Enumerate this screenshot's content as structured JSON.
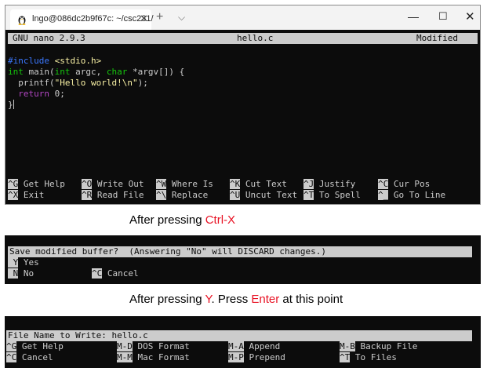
{
  "window": {
    "tab_title": "lngo@086dc2b9f67c: ~/csc231/",
    "close_glyph": "✕",
    "new_tab_glyph": "+",
    "dropdown_glyph": "⌵",
    "minimize_glyph": "—",
    "maximize_glyph": "☐",
    "window_close_glyph": "✕"
  },
  "nano": {
    "version": "GNU nano 2.9.3",
    "filename": "hello.c",
    "status": "Modified"
  },
  "code": {
    "line1_directive": "#include",
    "line1_header": "<stdio.h>",
    "line2_type": "int",
    "line2_a": " main(",
    "line2_type2": "int",
    "line2_b": " argc, ",
    "line2_type3": "char",
    "line2_c": " *argv[]) {",
    "line3_a": "  printf(",
    "line3_str": "\"Hello world!\\n\"",
    "line3_b": ");",
    "line4_indent": "  ",
    "line4_ret": "return",
    "line4_b": " 0;",
    "line5": "}"
  },
  "shortcuts": [
    {
      "key": "^G",
      "label": "Get Help"
    },
    {
      "key": "^O",
      "label": "Write Out"
    },
    {
      "key": "^W",
      "label": "Where Is"
    },
    {
      "key": "^K",
      "label": "Cut Text"
    },
    {
      "key": "^J",
      "label": "Justify"
    },
    {
      "key": "^C",
      "label": "Cur Pos"
    },
    {
      "key": "^X",
      "label": "Exit"
    },
    {
      "key": "^R",
      "label": "Read File"
    },
    {
      "key": "^\\",
      "label": "Replace"
    },
    {
      "key": "^U",
      "label": "Uncut Text"
    },
    {
      "key": "^T",
      "label": "To Spell"
    },
    {
      "key": "^_",
      "label": "Go To Line"
    }
  ],
  "caption1": {
    "prefix": "After pressing ",
    "key": "Ctrl-X"
  },
  "save_prompt": {
    "question": "Save modified buffer?  (Answering \"No\" will DISCARD changes.)",
    "options": [
      {
        "key": " Y",
        "label": "Yes"
      },
      {
        "key": " N",
        "label": "No"
      },
      {
        "key": "^C",
        "label": "Cancel"
      }
    ]
  },
  "caption2": {
    "prefix": "After pressing ",
    "key1": "Y",
    "mid": ". Press ",
    "key2": "Enter",
    "suffix": " at this point"
  },
  "filename_prompt": {
    "text": "File Name to Write: hello.c",
    "options": [
      {
        "key": "^G",
        "label": "Get Help"
      },
      {
        "key": "M-D",
        "label": "DOS Format"
      },
      {
        "key": "M-A",
        "label": "Append"
      },
      {
        "key": "M-B",
        "label": "Backup File"
      },
      {
        "key": "^C",
        "label": "Cancel"
      },
      {
        "key": "M-M",
        "label": "Mac Format"
      },
      {
        "key": "M-P",
        "label": "Prepend"
      },
      {
        "key": "^T",
        "label": "To Files"
      }
    ]
  },
  "colors": {
    "terminal_bg": "#0c0c0c",
    "terminal_fg": "#cccccc",
    "accent_red": "#e81123"
  }
}
